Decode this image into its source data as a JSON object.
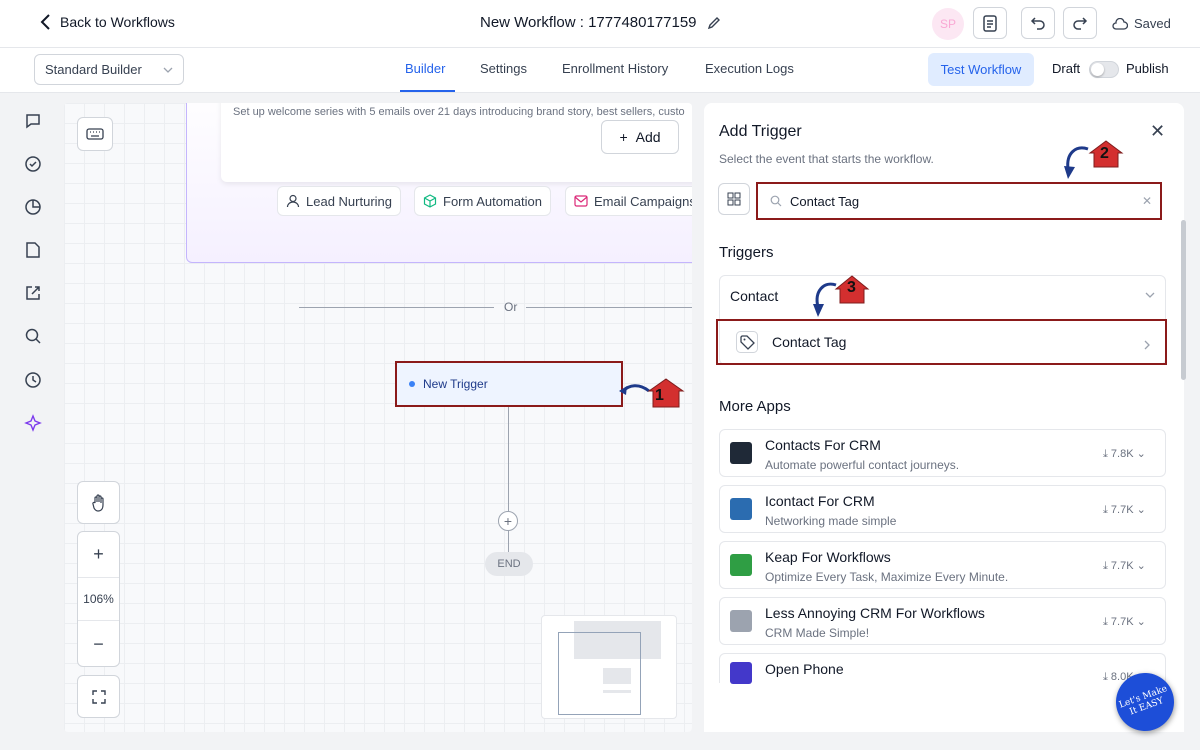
{
  "header": {
    "back_label": "Back to Workflows",
    "workflow_title": "New Workflow : 1777480177159",
    "avatar_initials": "SP",
    "saved_label": "Saved"
  },
  "subheader": {
    "builder_select": "Standard Builder",
    "tabs": [
      "Builder",
      "Settings",
      "Enrollment History",
      "Execution Logs"
    ],
    "active_tab": "Builder",
    "test_button": "Test Workflow",
    "draft_label": "Draft",
    "publish_label": "Publish"
  },
  "canvas": {
    "prompt_text": "Set up welcome series with 5 emails over 21 days introducing brand story, best sellers, custo",
    "add_button": "Add",
    "chips": [
      "Lead Nurturing",
      "Form Automation",
      "Email Campaigns"
    ],
    "or_label": "Or",
    "trigger_label": "New Trigger",
    "end_label": "END",
    "zoom": "106%",
    "zoom_in": "+",
    "zoom_out": "−"
  },
  "panel": {
    "title": "Add Trigger",
    "description": "Select the event that starts the workflow.",
    "search_value": "Contact Tag",
    "triggers_heading": "Triggers",
    "category": "Contact",
    "trigger_item": "Contact Tag",
    "more_apps_heading": "More Apps",
    "apps": [
      {
        "name": "Contacts For CRM",
        "desc": "Automate powerful contact journeys.",
        "count": "7.8K",
        "color": "#1f2937"
      },
      {
        "name": "Icontact For CRM",
        "desc": "Networking made simple",
        "count": "7.7K",
        "color": "#2b6cb0"
      },
      {
        "name": "Keap For Workflows",
        "desc": "Optimize Every Task, Maximize Every Minute.",
        "count": "7.7K",
        "color": "#2f9e44"
      },
      {
        "name": "Less Annoying CRM For Workflows",
        "desc": "CRM Made Simple!",
        "count": "7.7K",
        "color": "#9ca3af"
      },
      {
        "name": "Open Phone",
        "desc": "",
        "count": "8.0K",
        "color": "#4338ca"
      }
    ]
  },
  "annotations": {
    "step1": "1",
    "step2": "2",
    "step3": "3"
  },
  "watermark": "Let's Make It EASY"
}
